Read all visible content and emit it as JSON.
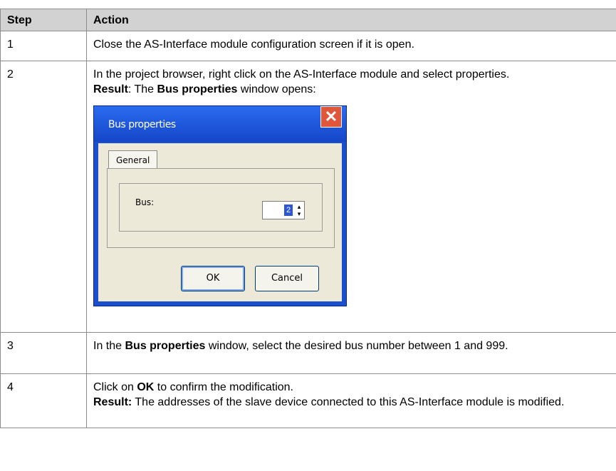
{
  "table": {
    "headers": {
      "step": "Step",
      "action": "Action"
    },
    "rows": [
      {
        "step": "1",
        "text": "Close the AS-Interface module configuration screen if it is open."
      },
      {
        "step": "2",
        "text": "In the project browser, right click on the AS-Interface module and select properties.",
        "result_label": "Result",
        "result_text_a": ": The ",
        "result_bold": "Bus properties",
        "result_text_b": " window opens:"
      },
      {
        "step": "3",
        "text_a": "In the ",
        "text_bold": "Bus properties",
        "text_b": " window, select the desired bus number between 1 and 999."
      },
      {
        "step": "4",
        "text_a": "Click on ",
        "text_bold": "OK",
        "text_b": " to confirm the modification.",
        "result_label": "Result:",
        "result_text": " The addresses of the slave device connected to this AS-Interface module is modified."
      }
    ]
  },
  "dialog": {
    "title": "Bus properties",
    "close_glyph": "✕",
    "tab_label": "General",
    "field_label": "Bus:",
    "field_value": "2",
    "spinner_glyph": "▴\n▾",
    "ok_label": "OK",
    "cancel_label": "Cancel"
  }
}
